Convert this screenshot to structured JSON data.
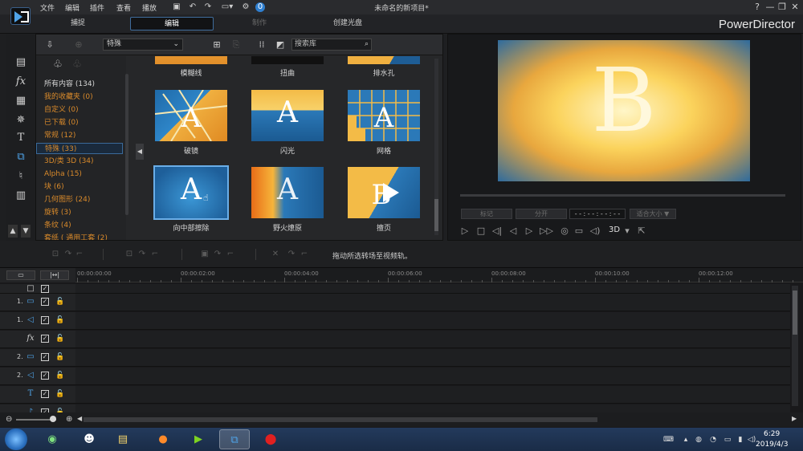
{
  "menu": [
    "文件",
    "编辑",
    "插件",
    "查看",
    "播放"
  ],
  "app_title": "未命名的新项目*",
  "notification_count": "0",
  "window_controls": {
    "help": "?",
    "minimize": "—",
    "restore": "❐",
    "close": "✕"
  },
  "modes": [
    {
      "label": "捕捉",
      "state": "normal"
    },
    {
      "label": "编辑",
      "state": "active"
    },
    {
      "label": "制作",
      "state": "disabled"
    },
    {
      "label": "创建光盘",
      "state": "normal"
    }
  ],
  "brand": "PowerDirector",
  "library": {
    "category": "特殊",
    "search_placeholder": "搜索库",
    "categories": [
      {
        "label": "所有内容 (134)",
        "type": "all"
      },
      {
        "label": "我的收藏夹 (0)"
      },
      {
        "label": "自定义 (0)"
      },
      {
        "label": "已下载 (0)"
      },
      {
        "label": "常规 (12)"
      },
      {
        "label": "特殊 (33)",
        "selected": true
      },
      {
        "label": "3D/类 3D (34)"
      },
      {
        "label": "Alpha (15)"
      },
      {
        "label": "块 (6)"
      },
      {
        "label": "几何图形 (24)"
      },
      {
        "label": "旋转 (3)"
      },
      {
        "label": "条纹 (4)"
      },
      {
        "label": "套纸 ( 通用工套 (2)"
      }
    ],
    "thumbnails": [
      {
        "label": "模糊线",
        "style": "top"
      },
      {
        "label": "扭曲",
        "style": "top-dark"
      },
      {
        "label": "排水孔",
        "style": "top"
      },
      {
        "label": "破镜",
        "style": "shatter"
      },
      {
        "label": "闪光",
        "style": "flash"
      },
      {
        "label": "网格",
        "style": "grid"
      },
      {
        "label": "向中部擦除",
        "style": "wipe",
        "selected": true
      },
      {
        "label": "野火燎原",
        "style": "fire"
      },
      {
        "label": "擅页",
        "style": "page"
      }
    ]
  },
  "preview": {
    "letter": "B",
    "btn_mark": "标记",
    "btn_mark2": "分开",
    "timecode": "- - : - - : - - : - -",
    "fit": "适合大小 ▼",
    "three_d": "3D"
  },
  "hint": "拖动所选转场至视频轨。",
  "timeline": {
    "ticks": [
      "00:00:00:00",
      "00:00:02:00",
      "00:00:04:00",
      "00:00:06:00",
      "00:00:08:00",
      "00:00:10:00",
      "00:00:12:00"
    ],
    "tracks": [
      {
        "num": "",
        "icon": "□",
        "kind": "master"
      },
      {
        "num": "1.",
        "icon": "▭",
        "kind": "video"
      },
      {
        "num": "1.",
        "icon": "◁",
        "kind": "audio"
      },
      {
        "num": "",
        "icon": "fx",
        "kind": "fx"
      },
      {
        "num": "2.",
        "icon": "▭",
        "kind": "video"
      },
      {
        "num": "2.",
        "icon": "◁",
        "kind": "audio"
      },
      {
        "num": "",
        "icon": "T",
        "kind": "title"
      },
      {
        "num": "",
        "icon": "♪",
        "kind": "voice"
      }
    ]
  },
  "taskbar": {
    "time": "6:29",
    "date": "2019/4/3"
  }
}
